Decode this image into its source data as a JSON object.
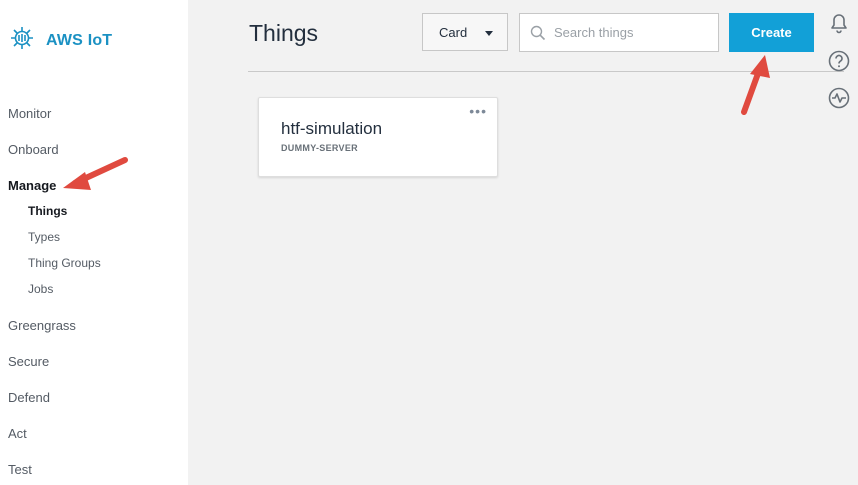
{
  "brand": {
    "name": "AWS IoT"
  },
  "sidebar": {
    "items": [
      {
        "label": "Monitor"
      },
      {
        "label": "Onboard"
      },
      {
        "label": "Manage"
      },
      {
        "label": "Greengrass"
      },
      {
        "label": "Secure"
      },
      {
        "label": "Defend"
      },
      {
        "label": "Act"
      },
      {
        "label": "Test"
      }
    ],
    "manage_subitems": [
      {
        "label": "Things"
      },
      {
        "label": "Types"
      },
      {
        "label": "Thing Groups"
      },
      {
        "label": "Jobs"
      }
    ]
  },
  "header": {
    "title": "Things",
    "view_select": "Card",
    "search_placeholder": "Search things",
    "create_label": "Create"
  },
  "things": [
    {
      "name": "htf-simulation",
      "type": "DUMMY-SERVER"
    }
  ],
  "icons": {
    "logo": "aws-iot-logo-icon",
    "search": "search-icon",
    "notifications": "bell-icon",
    "help": "help-icon",
    "activity": "activity-icon",
    "card_menu": "more-horizontal-icon"
  },
  "colors": {
    "brand": "#1b91c3",
    "primary_button": "#12a0d7",
    "annotation_arrow": "#e04a3f",
    "background": "#f2f2f2"
  }
}
